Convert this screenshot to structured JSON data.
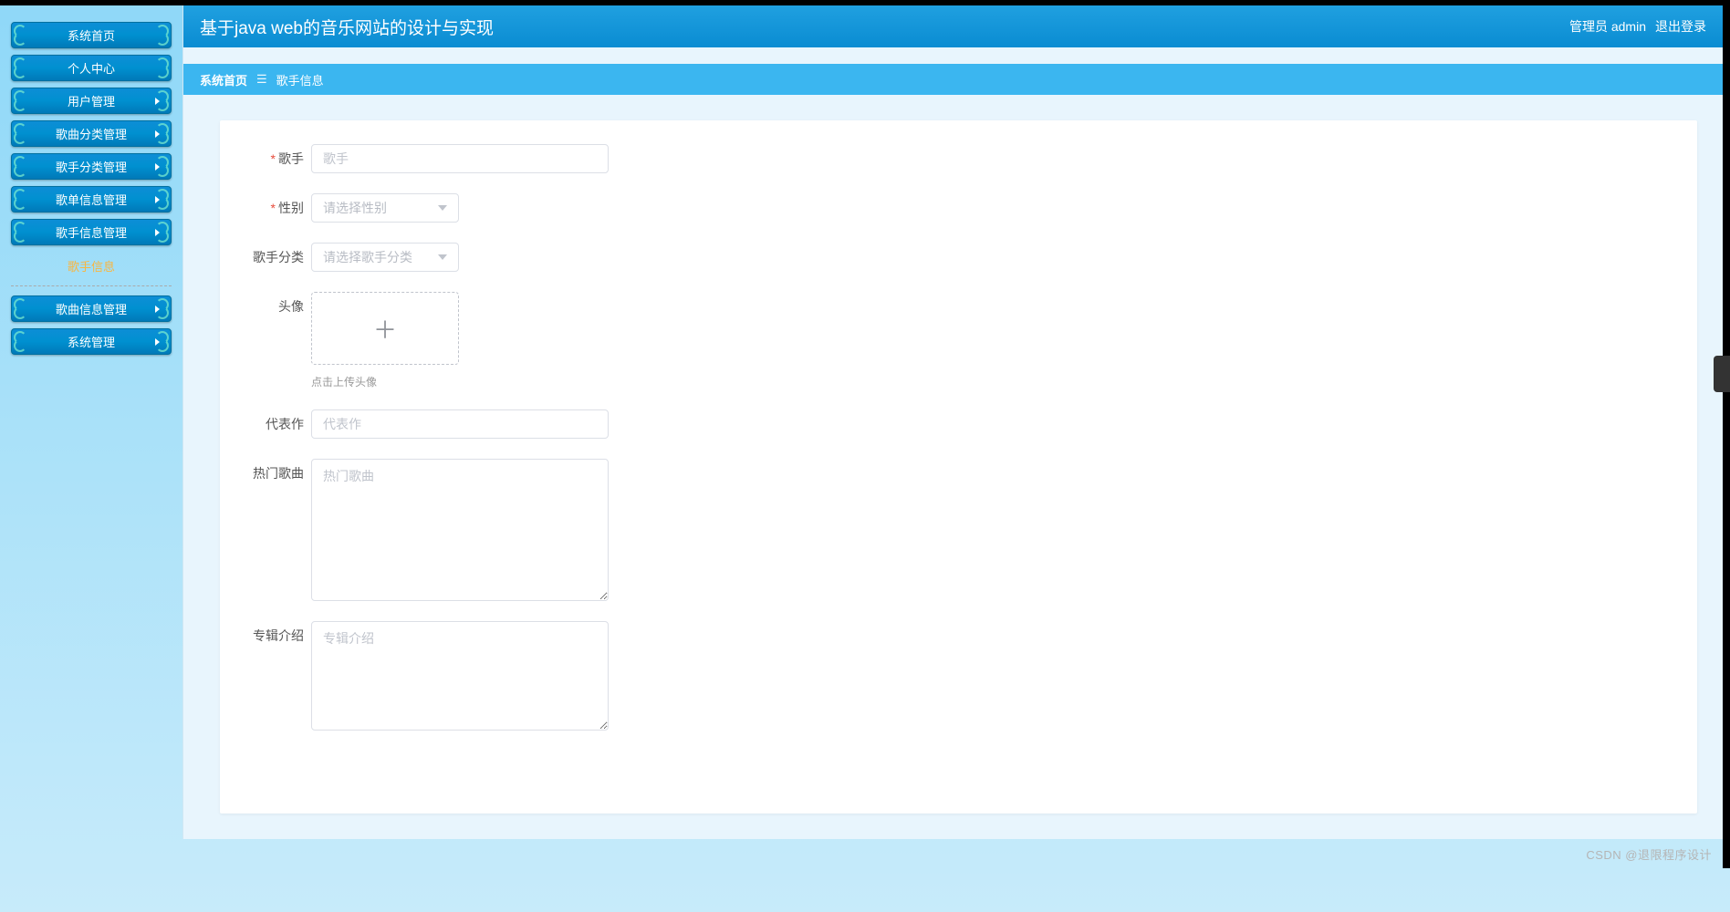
{
  "header": {
    "title": "基于java web的音乐网站的设计与实现",
    "role_label": "管理员 admin",
    "logout": "退出登录"
  },
  "sidebar": {
    "items": [
      {
        "label": "系统首页",
        "expandable": false
      },
      {
        "label": "个人中心",
        "expandable": false
      },
      {
        "label": "用户管理",
        "expandable": true
      },
      {
        "label": "歌曲分类管理",
        "expandable": true
      },
      {
        "label": "歌手分类管理",
        "expandable": true
      },
      {
        "label": "歌单信息管理",
        "expandable": true
      },
      {
        "label": "歌手信息管理",
        "expandable": true
      }
    ],
    "active_sub": "歌手信息",
    "items2": [
      {
        "label": "歌曲信息管理",
        "expandable": true
      },
      {
        "label": "系统管理",
        "expandable": true
      }
    ]
  },
  "breadcrumb": {
    "root": "系统首页",
    "current": "歌手信息"
  },
  "form": {
    "singer": {
      "label": "歌手",
      "placeholder": "歌手",
      "required": true
    },
    "gender": {
      "label": "性别",
      "placeholder": "请选择性别",
      "required": true
    },
    "category": {
      "label": "歌手分类",
      "placeholder": "请选择歌手分类",
      "required": false
    },
    "avatar": {
      "label": "头像",
      "hint": "点击上传头像"
    },
    "representative": {
      "label": "代表作",
      "placeholder": "代表作"
    },
    "hot_songs": {
      "label": "热门歌曲",
      "placeholder": "热门歌曲"
    },
    "album_intro": {
      "label": "专辑介绍",
      "placeholder": "专辑介绍"
    }
  },
  "watermark": "CSDN @退限程序设计"
}
